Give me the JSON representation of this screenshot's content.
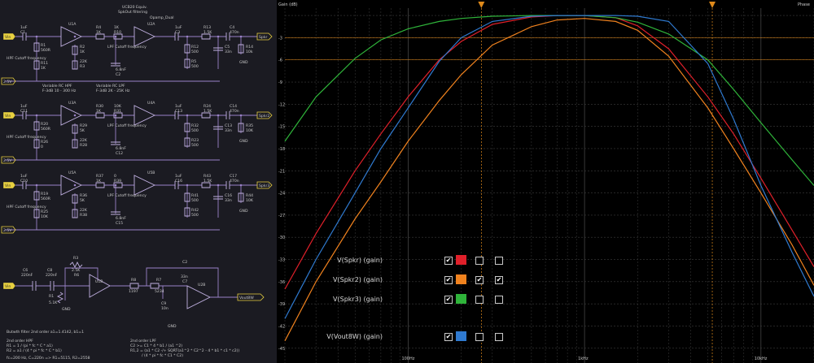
{
  "schematic": {
    "title": "UCB20 Equiv.",
    "subtitle": "SpkOut filtering",
    "stages": [
      {
        "input_tag": "Vin",
        "output_tag": "Spkr",
        "ref_tag": "2.5V",
        "opamp1": "U1A",
        "opamp2": "U2A",
        "opamp2_note": "Opamp_Dual",
        "c_in": "1uF",
        "c_in_ref": "C1",
        "r_pot": "560R",
        "r_pot_ref": "R1",
        "r_lo": "1K",
        "r_lo_ref": "R11",
        "hpf_note": "HPF Cutoff frequency",
        "hpf_range": "Variable RC HPF",
        "hpf_range2": "F-3dB 10 - 300 Hz",
        "r2": "1K",
        "r2_ref": "R2",
        "r22k": "22K",
        "r22k_ref": "R3",
        "r_a": "1K",
        "r_a_ref": "R4",
        "r_b": "1K",
        "r_b_ref": "R10",
        "lpf_note": "LPF Cutoff frequency",
        "lpf_range": "Variable RC LPF",
        "lpf_range2": "F-3dB 2K - 25K Hz",
        "c_lpf": "6.8nF",
        "c_lpf_ref": "C2",
        "c_out": "1uF",
        "c_out_ref": "C3",
        "r15": "1.5K",
        "r15_ref": "R13",
        "c4": "470n",
        "c4_ref": "C4",
        "r12": "500",
        "r12_ref": "R12",
        "c5": "33n",
        "c5_ref": "C5",
        "r14": "10k",
        "r14_ref": "R14",
        "r_gnd": "500",
        "r_gnd_ref": "R5"
      },
      {
        "input_tag": "Vin",
        "output_tag": "Spkr2",
        "ref_tag": "2.5V",
        "opamp1": "U3A",
        "opamp2": "U4A",
        "opamp2_note": "",
        "c_in": "1uF",
        "c_in_ref": "C11",
        "r_pot": "560R",
        "r_pot_ref": "R20",
        "r_lo": "0",
        "r_lo_ref": "R26",
        "hpf_note": "HPF Cutoff frequency",
        "hpf_range": "",
        "hpf_range2": "",
        "r2": "5K",
        "r2_ref": "R29",
        "r22k": "22K",
        "r22k_ref": "R28",
        "r_a": "1K",
        "r_a_ref": "R30",
        "r_b": "10K",
        "r_b_ref": "R31",
        "lpf_note": "LPF Cutoff frequency",
        "lpf_range": "",
        "lpf_range2": "",
        "c_lpf": "6.8nF",
        "c_lpf_ref": "C12",
        "c_out": "1uF",
        "c_out_ref": "C13",
        "r15": "1.5K",
        "r15_ref": "R24",
        "c4": "470n",
        "c4_ref": "C14",
        "r12": "500",
        "r12_ref": "R32",
        "c5": "33n",
        "c5_ref": "C13",
        "r14": "10K",
        "r14_ref": "R35",
        "r_gnd": "500",
        "r_gnd_ref": "R23"
      },
      {
        "input_tag": "Vin",
        "output_tag": "Spkr3",
        "ref_tag": "2.5V",
        "opamp1": "U5A",
        "opamp2": "U5B",
        "opamp2_note": "",
        "c_in": "1uF",
        "c_in_ref": "C10",
        "r_pot": "560R",
        "r_pot_ref": "R19",
        "r_lo": "10K",
        "r_lo_ref": "R25",
        "hpf_note": "HPF Cutoff frequency",
        "hpf_range": "",
        "hpf_range2": "",
        "r2": "5K",
        "r2_ref": "R36",
        "r22k": "22K",
        "r22k_ref": "R38",
        "r_a": "1K",
        "r_a_ref": "R37",
        "r_b": "0",
        "r_b_ref": "R39",
        "lpf_note": "LPF Cutoff frequency",
        "lpf_range": "",
        "lpf_range2": "",
        "c_lpf": "6.8nF",
        "c_lpf_ref": "C15",
        "c_out": "1uF",
        "c_out_ref": "C16",
        "r15": "1.5K",
        "r15_ref": "R43",
        "c4": "470n",
        "c4_ref": "C17",
        "r12": "500",
        "r12_ref": "R41",
        "c5": "33n",
        "c5_ref": "C16",
        "r14": "10K",
        "r14_ref": "R44",
        "r_gnd": "500",
        "r_gnd_ref": "R42"
      }
    ],
    "gnd_label": "GND",
    "bw_stage": {
      "input_tag": "Vin",
      "output_tag": "Vout8W",
      "c6": "220nF",
      "c6_ref": "C6",
      "c8": "220nF",
      "c8_ref": "C8",
      "r3": "2.5K",
      "r3_ref": "R3",
      "r6": "R6",
      "r1": "5.1K",
      "r1_ref": "R1",
      "u1": "U1B",
      "r8": "1197",
      "r8_ref": "R8",
      "r7": "5234",
      "r7_ref": "R7",
      "c7": "33n",
      "c7_ref": "C7",
      "c2_ref": "C2",
      "c9": "10n",
      "c9_ref": "C9",
      "u2": "U2B"
    },
    "notes": {
      "bw_title": "Butwth filter 2nd order a1=1.4142, b1=1",
      "hpf_title": "2nd order HPF",
      "hpf_eq1": "R1 = 1 / (pi * fc * C * a1)",
      "hpf_eq2": "R2 = a1 / (4 * pi * fc * C * b1)",
      "lpf_title": "2nd order LPF",
      "lpf_eq1": "C2 >= C1 * 4 * b1 / (a1 ^2)",
      "lpf_eq2": "R1,2 = (a1 * C2 -/+ SQRT(a1^2 * C2^2 - 4 * b1 * c1 * c2))",
      "lpf_eq3": "/ (4 * pi * fc * C1 * C2)",
      "result": "fc=200 Hz, C=220n => R1=5115, R2=2558"
    }
  },
  "plot": {
    "y_axis_label": "Gain (dB)",
    "right_axis_label": "Phase",
    "y_ticks": [
      "-3",
      "-6",
      "-9",
      "-12",
      "-15",
      "-18",
      "-21",
      "-24",
      "-27",
      "-30",
      "-33",
      "-36",
      "-39",
      "-42",
      "-45"
    ],
    "x_ticks": [
      "100Hz",
      "1kHz",
      "10kHz"
    ],
    "cursor_color": "#e08a1a",
    "grid_color": "#3c3c3c",
    "legend": [
      {
        "label": "V(Spkr) (gain)",
        "color": "#e0202a",
        "checks": [
          true,
          false,
          false
        ]
      },
      {
        "label": "V(Spkr2) (gain)",
        "color": "#f0821e",
        "checks": [
          true,
          true,
          true
        ]
      },
      {
        "label": "V(Spkr3) (gain)",
        "color": "#2fb43a",
        "checks": [
          true,
          false,
          false
        ]
      },
      {
        "label": "V(Vout8W) (gain)",
        "color": "#2f7ad0",
        "checks": [
          true,
          false,
          false
        ]
      }
    ],
    "legend_check_mark": "✔",
    "swatch_colors": [
      "#e0202a",
      "#f0821e",
      "#2fb43a",
      "#2f7ad0"
    ]
  },
  "chart_data": {
    "type": "line",
    "xlabel": "",
    "ylabel": "Gain (dB)",
    "x_scale": "log",
    "xlim": [
      20,
      20000
    ],
    "ylim": [
      -47,
      1
    ],
    "series": [
      {
        "name": "V(Spkr) (gain)",
        "color": "#e0202a",
        "x": [
          20,
          30,
          50,
          70,
          100,
          150,
          200,
          300,
          500,
          700,
          1000,
          1500,
          2000,
          3000,
          5000,
          7000,
          10000,
          15000,
          20000
        ],
        "y": [
          -37,
          -29.5,
          -21,
          -16,
          -11,
          -6,
          -3.5,
          -1.2,
          -0.2,
          0,
          0,
          -0.3,
          -1.4,
          -4.5,
          -11,
          -16,
          -22,
          -29,
          -34
        ]
      },
      {
        "name": "V(Spkr2) (gain)",
        "color": "#f0821e",
        "x": [
          20,
          30,
          50,
          70,
          100,
          150,
          200,
          300,
          500,
          700,
          1000,
          1500,
          2000,
          3000,
          5000,
          7000,
          10000,
          15000,
          20000
        ],
        "y": [
          -44,
          -36,
          -27.5,
          -22.5,
          -17,
          -11.5,
          -8,
          -4,
          -1.5,
          -0.6,
          -0.4,
          -0.8,
          -2,
          -5.5,
          -12.5,
          -18,
          -24,
          -31,
          -36.5
        ]
      },
      {
        "name": "V(Spkr3) (gain)",
        "color": "#2fb43a",
        "x": [
          20,
          30,
          50,
          70,
          100,
          150,
          200,
          300,
          500,
          700,
          1000,
          1500,
          2000,
          3000,
          5000,
          7000,
          10000,
          15000,
          20000
        ],
        "y": [
          -17,
          -11,
          -5.8,
          -3.3,
          -1.8,
          -0.8,
          -0.4,
          -0.1,
          0,
          0,
          0,
          -0.3,
          -0.9,
          -2.5,
          -6,
          -10,
          -14.5,
          -19.5,
          -23
        ]
      },
      {
        "name": "V(Vout8W) (gain)",
        "color": "#2f7ad0",
        "x": [
          20,
          30,
          50,
          70,
          100,
          150,
          200,
          300,
          500,
          700,
          1000,
          1500,
          2000,
          3000,
          5000,
          7000,
          10000,
          15000,
          20000
        ],
        "y": [
          -41,
          -33,
          -24,
          -18,
          -12.5,
          -6.2,
          -3,
          -0.8,
          -0.1,
          0,
          0,
          0,
          -0.1,
          -0.8,
          -6.5,
          -14,
          -23,
          -32,
          -38
        ]
      }
    ],
    "cursors_x": [
      260,
      5300
    ],
    "cursor_levels_db": [
      -3,
      -6
    ]
  }
}
